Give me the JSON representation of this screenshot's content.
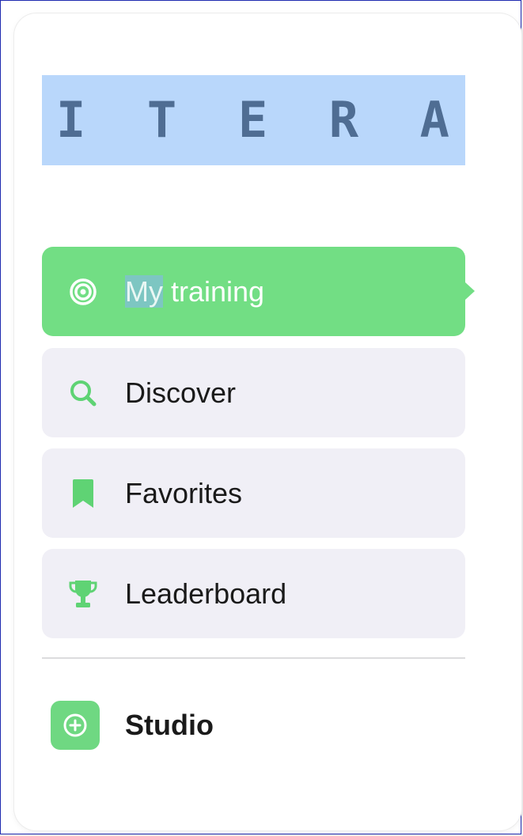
{
  "logo": {
    "letters": [
      "I",
      "T",
      "E",
      "R",
      "A"
    ]
  },
  "nav": {
    "items": [
      {
        "label_highlight": "My",
        "label_rest": " training",
        "icon": "target-icon",
        "active": true
      },
      {
        "label": "Discover",
        "icon": "search-icon",
        "active": false
      },
      {
        "label": "Favorites",
        "icon": "bookmark-icon",
        "active": false
      },
      {
        "label": "Leaderboard",
        "icon": "trophy-icon",
        "active": false
      }
    ]
  },
  "studio": {
    "label": "Studio",
    "icon": "add-circle-icon"
  },
  "colors": {
    "accent": "#72de84",
    "logo_bg": "#b9d7fb",
    "logo_text": "#4f6d93",
    "item_bg": "#f0eff6",
    "frame_border": "#1f2bb0"
  }
}
